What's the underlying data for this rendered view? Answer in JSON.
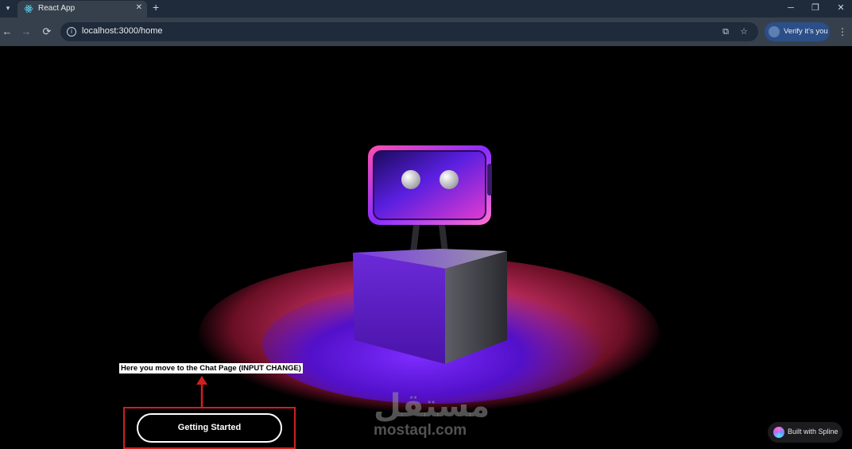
{
  "browser": {
    "tab": {
      "title": "React App",
      "favicon": "react-icon"
    },
    "address_bar": {
      "url": "localhost:3000/home"
    },
    "profile_button": {
      "label": "Verify it's you"
    },
    "icons": [
      "tab-search-icon",
      "close-icon",
      "plus-icon",
      "minimize-icon",
      "restore-icon",
      "back-icon",
      "forward-icon",
      "reload-icon",
      "info-icon",
      "install-app-icon",
      "star-icon",
      "more-vert-icon"
    ]
  },
  "page": {
    "callout_text": "Here you move to the Chat Page (INPUT CHANGE)",
    "cta_button": {
      "label": "Getting Started"
    },
    "watermark": {
      "arabic": "مستقل",
      "latin": "mostaql.com"
    },
    "spline_badge": {
      "label": "Built with Spline"
    }
  },
  "colors": {
    "highlight_red": "#d11f1f",
    "robot_purple": "#6a1fd6",
    "robot_pink": "#e23bd0",
    "glow_red": "#b82a5a"
  }
}
